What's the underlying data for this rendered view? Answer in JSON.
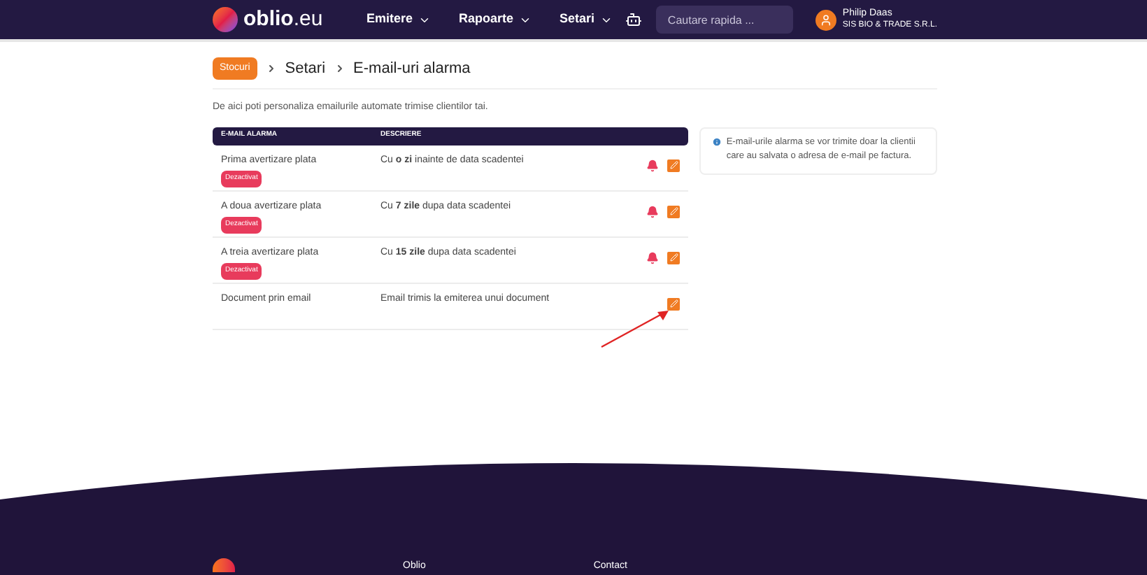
{
  "header": {
    "logo": "**oblio**.eu",
    "nav": [
      {
        "label": "Emitere"
      },
      {
        "label": "Rapoarte"
      },
      {
        "label": "Setari"
      }
    ],
    "search": {
      "placeholder": "Cautare rapida ..."
    },
    "user": {
      "name": "Philip Daas",
      "company": "SIS BIO & TRADE S.R.L."
    }
  },
  "breadcrumb": [
    {
      "label": "Stocuri",
      "kind": "tag"
    },
    {
      "label": "Setari",
      "kind": "text"
    },
    {
      "label": "E-mail-uri alarma",
      "kind": "text"
    }
  ],
  "intro": "De aici poti personaliza emailurile automate trimise clientilor tai.",
  "table": {
    "columns": [
      "E-MAIL ALARMA",
      "DESCRIERE"
    ],
    "rows": [
      {
        "name": "Prima avertizare plata",
        "badge": "Dezactivat",
        "description": "Cu **o zi** inainte de data scadentei",
        "bell": true
      },
      {
        "name": "A doua avertizare plata",
        "badge": "Dezactivat",
        "description": "Cu **7 zile** dupa data scadentei",
        "bell": true
      },
      {
        "name": "A treia avertizare plata",
        "badge": "Dezactivat",
        "description": "Cu **15 zile** dupa data scadentei",
        "bell": true
      },
      {
        "name": "Document prin email",
        "description": "Email trimis la emiterea unui document",
        "bell": false
      }
    ]
  },
  "info": "E-mail-urile alarma se vor trimite doar la clientii care au salvata o adresa de e-mail pe factura.",
  "footer": {
    "columns": [
      "Oblio",
      "Contact"
    ]
  }
}
